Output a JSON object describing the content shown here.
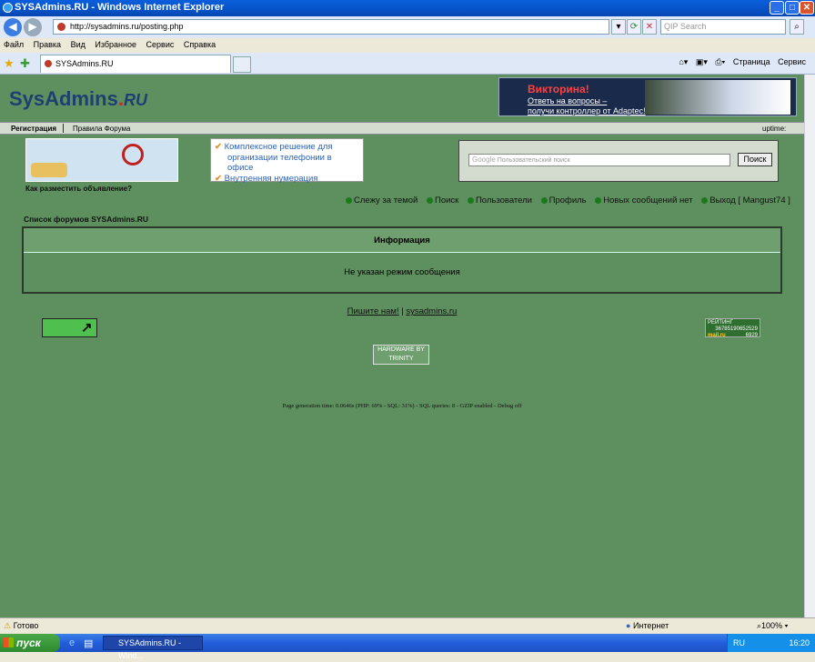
{
  "window": {
    "title": "SYSAdmins.RU - Windows Internet Explorer"
  },
  "address_bar": {
    "url": "http://sysadmins.ru/posting.php",
    "search_placeholder": "QIP Search"
  },
  "menu": [
    "Файл",
    "Правка",
    "Вид",
    "Избранное",
    "Сервис",
    "Справка"
  ],
  "tab": {
    "label": "SYSAdmins.RU"
  },
  "toolbar": {
    "page_label": "Страница",
    "tools_label": "Сервис"
  },
  "site": {
    "logo_main": "SysAdmins",
    "logo_suffix": "RU",
    "banner": {
      "title": "Викторина!",
      "line1": "Ответь на вопросы –",
      "line2": "получи контроллер от Adaptec!"
    },
    "nav": {
      "register": "Регистрация",
      "rules": "Правила Форума",
      "uptime": "uptime:"
    },
    "ad_caption": "Как разместить объявление?",
    "ad2": {
      "line1": "Комплексное решение для",
      "line2": "организации телефонии в офисе",
      "line3": "Внутренняя нумерация"
    },
    "search": {
      "placeholder": "Пользовательский поиск",
      "brand": "Google",
      "button": "Поиск"
    },
    "user_links": [
      "Слежу за темой",
      "Поиск",
      "Пользователи",
      "Профиль",
      "Новых сообщений нет",
      "Выход [ Mangust74 ]"
    ],
    "forum_list": "Список форумов SYSAdmins.RU",
    "info": {
      "header": "Информация",
      "message": "Не указан режим сообщения"
    },
    "footer": {
      "write_us": "Пишите нам!",
      "sep": "|",
      "site_link": "sysadmins.ru"
    },
    "counter": {
      "label": "РЕЙТИНГ",
      "n1": "190652529",
      "n2": "36785",
      "n3": "6929",
      "brand": "mail.ru"
    },
    "trinity": {
      "line1": "HARDWARE BY",
      "line2": "TRINITY"
    },
    "generation": "Page generation time: 0.0646s (PHP: 69% - SQL: 31%) - SQL queries: 8 - GZIP enabled - Debug off"
  },
  "status": {
    "text": "Готово",
    "zone": "Интернет",
    "zoom": "100%"
  },
  "taskbar": {
    "start": "пуск",
    "task": "SYSAdmins.RU - Wind...",
    "lang": "RU",
    "clock": "16:20"
  }
}
